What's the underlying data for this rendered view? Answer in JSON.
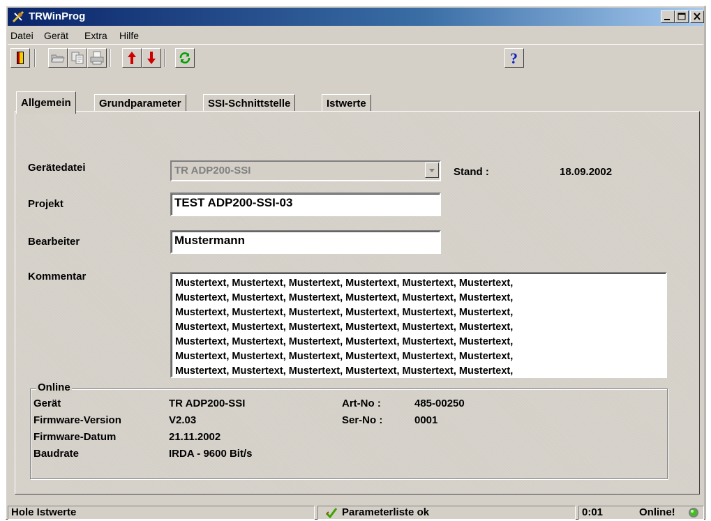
{
  "window": {
    "title": "TRWinProg"
  },
  "menu": [
    {
      "label": "Datei"
    },
    {
      "label": "Gerät"
    },
    {
      "label": "Extra"
    },
    {
      "label": "Hilfe"
    }
  ],
  "toolbar": {
    "icons": [
      "exit-icon",
      "open-folder-icon",
      "copy-icon",
      "print-icon",
      "upload-icon",
      "download-icon",
      "refresh-icon",
      "help-icon"
    ]
  },
  "tabs": [
    {
      "label": "Allgemein",
      "active": true
    },
    {
      "label": "Grundparameter"
    },
    {
      "label": "SSI-Schnittstelle"
    },
    {
      "label": "Istwerte"
    }
  ],
  "form": {
    "geraetedatei_label": "Gerätedatei",
    "geraetedatei_value": "TR ADP200-SSI",
    "stand_label": "Stand :",
    "stand_value": "18.09.2002",
    "projekt_label": "Projekt",
    "projekt_value": "TEST ADP200-SSI-03",
    "bearbeiter_label": "Bearbeiter",
    "bearbeiter_value": "Mustermann",
    "kommentar_label": "Kommentar",
    "kommentar_lines": [
      "Mustertext, Mustertext, Mustertext, Mustertext, Mustertext, Mustertext,",
      "Mustertext, Mustertext, Mustertext, Mustertext, Mustertext, Mustertext,",
      "Mustertext, Mustertext, Mustertext, Mustertext, Mustertext, Mustertext,",
      "Mustertext, Mustertext, Mustertext, Mustertext, Mustertext, Mustertext,",
      "Mustertext, Mustertext, Mustertext, Mustertext, Mustertext, Mustertext,",
      "Mustertext, Mustertext, Mustertext, Mustertext, Mustertext, Mustertext,",
      "Mustertext, Mustertext, Mustertext, Mustertext, Mustertext, Mustertext,"
    ]
  },
  "online": {
    "title": "Online",
    "geraet_label": "Gerät",
    "geraet_value": "TR ADP200-SSI",
    "firmware_version_label": "Firmware-Version",
    "firmware_version_value": "V2.03",
    "firmware_datum_label": "Firmware-Datum",
    "firmware_datum_value": "21.11.2002",
    "baudrate_label": "Baudrate",
    "baudrate_value": "IRDA - 9600 Bit/s",
    "art_no_label": "Art-No :",
    "art_no_value": "485-00250",
    "ser_no_label": "Ser-No :",
    "ser_no_value": "0001"
  },
  "status": {
    "left": "Hole Istwerte",
    "middle": "Parameterliste ok",
    "time": "0:01",
    "online": "Online!"
  },
  "colors": {
    "title_start": "#0a246a",
    "title_end": "#a6caf0",
    "face": "#d4d0c8",
    "arrow_red": "#d00000",
    "refresh_green": "#00a000",
    "help_blue": "#1020c0"
  }
}
